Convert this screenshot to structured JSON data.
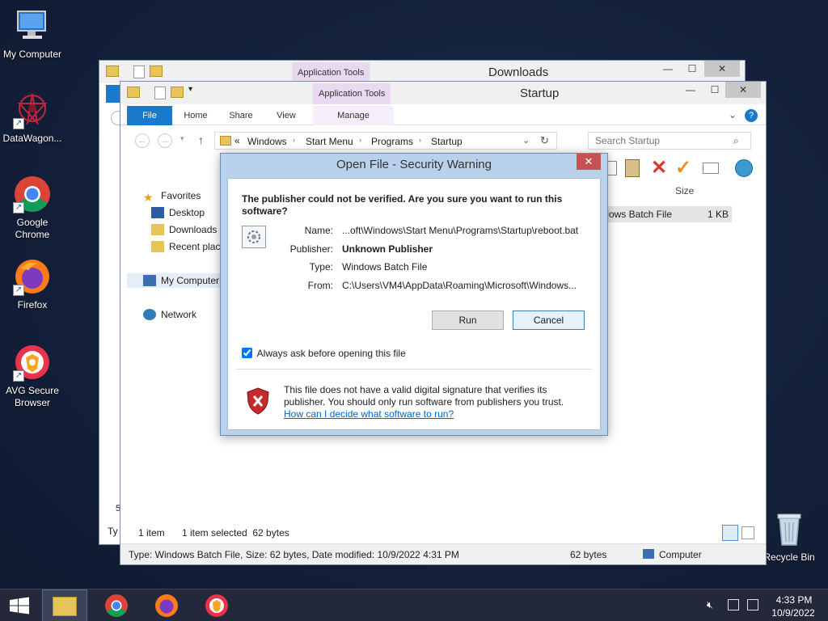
{
  "desktop": {
    "icons": [
      {
        "label": "My Computer"
      },
      {
        "label": "DataWagon..."
      },
      {
        "label": "Google Chrome"
      },
      {
        "label": "Firefox"
      },
      {
        "label": "AVG Secure Browser"
      },
      {
        "label": "Recycle Bin"
      }
    ]
  },
  "downloads_window": {
    "context_tab": "Application Tools",
    "title": "Downloads"
  },
  "startup_window": {
    "context_tab": "Application Tools",
    "title": "Startup",
    "tabs": [
      "File",
      "Home",
      "Share",
      "View",
      "Manage"
    ],
    "breadcrumb": [
      "Windows",
      "Start Menu",
      "Programs",
      "Startup"
    ],
    "search_placeholder": "Search Startup",
    "nav": {
      "favorites": "Favorites",
      "desktop": "Desktop",
      "downloads": "Downloads",
      "recent": "Recent places",
      "computer": "My Computer",
      "network": "Network"
    },
    "columns": {
      "size": "Size"
    },
    "file_row": {
      "type": "Windows Batch File",
      "size": "1 KB"
    },
    "status": {
      "items": "1 item",
      "selected": "1 item selected  62 bytes"
    },
    "detail_bar": {
      "text": "Type: Windows Batch File, Size: 62 bytes, Date modified: 10/9/2022 4:31 PM",
      "size": "62 bytes",
      "location": "Computer"
    }
  },
  "dialog": {
    "title": "Open File - Security Warning",
    "question": "The publisher could not be verified.  Are you sure you want to run this software?",
    "fields": {
      "name_label": "Name:",
      "name_value": "...oft\\Windows\\Start Menu\\Programs\\Startup\\reboot.bat",
      "publisher_label": "Publisher:",
      "publisher_value": "Unknown Publisher",
      "type_label": "Type:",
      "type_value": "Windows Batch File",
      "from_label": "From:",
      "from_value": "C:\\Users\\VM4\\AppData\\Roaming\\Microsoft\\Windows..."
    },
    "run_label": "Run",
    "cancel_label": "Cancel",
    "checkbox_label": "Always ask before opening this file",
    "checkbox_checked": true,
    "warning_text": "This file does not have a valid digital signature that verifies its publisher.  You should only run software from publishers you trust.",
    "help_link": "How can I decide what software to run?"
  },
  "taskbar": {
    "time": "4:33 PM",
    "date": "10/9/2022"
  },
  "colors": {
    "accent": "#1979ca",
    "dialog_frame": "#b9d1ea",
    "link": "#0066cc",
    "close_red": "#c75050"
  }
}
